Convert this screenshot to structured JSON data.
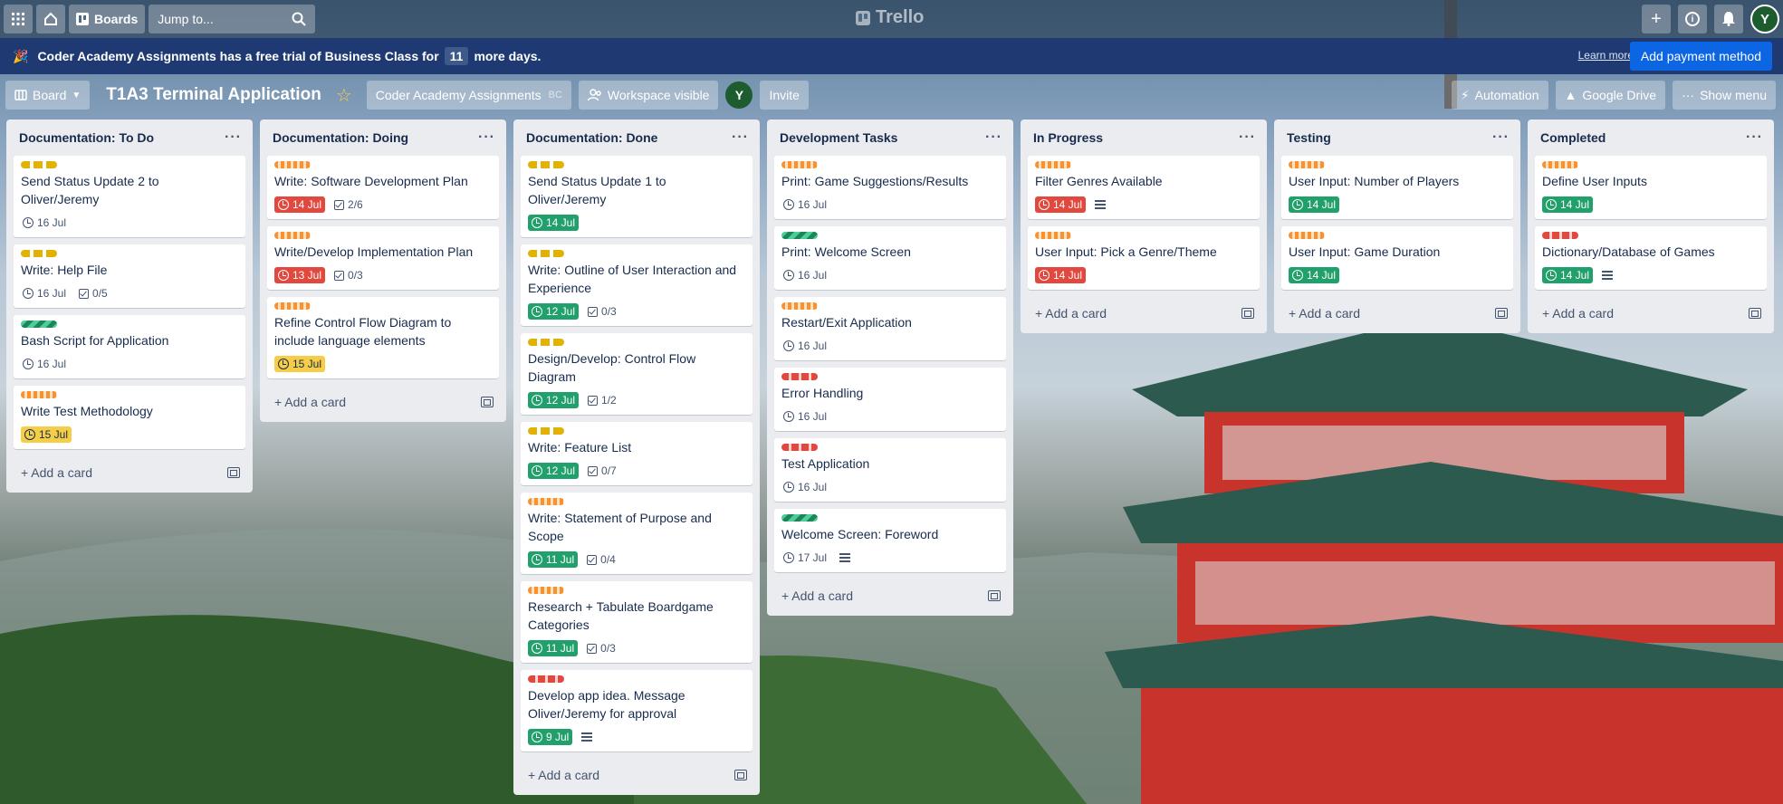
{
  "app": {
    "name": "Trello",
    "search_placeholder": "Jump to...",
    "boards_label": "Boards",
    "avatar_initial": "Y"
  },
  "banner": {
    "text_before": "Coder Academy Assignments has a free trial of Business Class for",
    "days": "11",
    "text_after": "more days.",
    "learn_more": "Learn more",
    "payment_button": "Add payment method"
  },
  "board_header": {
    "view_label": "Board",
    "title": "T1A3 Terminal Application",
    "workspace": "Coder Academy Assignments",
    "workspace_badge": "BC",
    "visibility": "Workspace visible",
    "invite": "Invite",
    "automation": "Automation",
    "google_drive": "Google Drive",
    "show_menu": "Show menu"
  },
  "add_card_label": "Add a card",
  "lists": [
    {
      "name": "Documentation: To Do",
      "cards": [
        {
          "labels": [
            "yellow"
          ],
          "title": "Send Status Update 2 to Oliver/Jeremy",
          "due": "16 Jul",
          "due_style": "plain",
          "checklist": "",
          "desc": false
        },
        {
          "labels": [
            "yellow"
          ],
          "title": "Write: Help File",
          "due": "16 Jul",
          "due_style": "plain",
          "checklist": "0/5",
          "desc": false
        },
        {
          "labels": [
            "green"
          ],
          "title": "Bash Script for Application",
          "due": "16 Jul",
          "due_style": "plain",
          "checklist": "",
          "desc": false
        },
        {
          "labels": [
            "orange"
          ],
          "title": "Write Test Methodology",
          "due": "15 Jul",
          "due_style": "yellow",
          "checklist": "",
          "desc": false
        }
      ]
    },
    {
      "name": "Documentation: Doing",
      "cards": [
        {
          "labels": [
            "orange"
          ],
          "title": "Write: Software Development Plan",
          "due": "14 Jul",
          "due_style": "red",
          "checklist": "2/6",
          "desc": false
        },
        {
          "labels": [
            "orange"
          ],
          "title": "Write/Develop Implementation Plan",
          "due": "13 Jul",
          "due_style": "red",
          "checklist": "0/3",
          "desc": false
        },
        {
          "labels": [
            "orange"
          ],
          "title": "Refine Control Flow Diagram to include language elements",
          "due": "15 Jul",
          "due_style": "yellow",
          "checklist": "",
          "desc": false
        }
      ]
    },
    {
      "name": "Documentation: Done",
      "cards": [
        {
          "labels": [
            "yellow"
          ],
          "title": "Send Status Update 1 to Oliver/Jeremy",
          "due": "14 Jul",
          "due_style": "green",
          "checklist": "",
          "desc": false
        },
        {
          "labels": [
            "yellow"
          ],
          "title": "Write: Outline of User Interaction and Experience",
          "due": "12 Jul",
          "due_style": "green",
          "checklist": "0/3",
          "desc": false
        },
        {
          "labels": [
            "yellow"
          ],
          "title": "Design/Develop: Control Flow Diagram",
          "due": "12 Jul",
          "due_style": "green",
          "checklist": "1/2",
          "desc": false
        },
        {
          "labels": [
            "yellow"
          ],
          "title": "Write: Feature List",
          "due": "12 Jul",
          "due_style": "green",
          "checklist": "0/7",
          "desc": false
        },
        {
          "labels": [
            "orange"
          ],
          "title": "Write: Statement of Purpose and Scope",
          "due": "11 Jul",
          "due_style": "green",
          "checklist": "0/4",
          "desc": false
        },
        {
          "labels": [
            "orange"
          ],
          "title": "Research + Tabulate Boardgame Categories",
          "due": "11 Jul",
          "due_style": "green",
          "checklist": "0/3",
          "desc": false
        },
        {
          "labels": [
            "red"
          ],
          "title": "Develop app idea. Message Oliver/Jeremy for approval",
          "due": "9 Jul",
          "due_style": "green",
          "checklist": "",
          "desc": true
        }
      ]
    },
    {
      "name": "Development Tasks",
      "cards": [
        {
          "labels": [
            "orange"
          ],
          "title": "Print: Game Suggestions/Results",
          "due": "16 Jul",
          "due_style": "plain",
          "checklist": "",
          "desc": false
        },
        {
          "labels": [
            "green"
          ],
          "title": "Print: Welcome Screen",
          "due": "16 Jul",
          "due_style": "plain",
          "checklist": "",
          "desc": false
        },
        {
          "labels": [
            "orange"
          ],
          "title": "Restart/Exit Application",
          "due": "16 Jul",
          "due_style": "plain",
          "checklist": "",
          "desc": false
        },
        {
          "labels": [
            "red"
          ],
          "title": "Error Handling",
          "due": "16 Jul",
          "due_style": "plain",
          "checklist": "",
          "desc": false
        },
        {
          "labels": [
            "red"
          ],
          "title": "Test Application",
          "due": "16 Jul",
          "due_style": "plain",
          "checklist": "",
          "desc": false
        },
        {
          "labels": [
            "green"
          ],
          "title": "Welcome Screen: Foreword",
          "due": "17 Jul",
          "due_style": "plain",
          "checklist": "",
          "desc": true
        }
      ]
    },
    {
      "name": "In Progress",
      "cards": [
        {
          "labels": [
            "orange"
          ],
          "title": "Filter Genres Available",
          "due": "14 Jul",
          "due_style": "red",
          "checklist": "",
          "desc": true
        },
        {
          "labels": [
            "orange"
          ],
          "title": "User Input: Pick a Genre/Theme",
          "due": "14 Jul",
          "due_style": "red",
          "checklist": "",
          "desc": false
        }
      ]
    },
    {
      "name": "Testing",
      "cards": [
        {
          "labels": [
            "orange"
          ],
          "title": "User Input: Number of Players",
          "due": "14 Jul",
          "due_style": "green",
          "checklist": "",
          "desc": false
        },
        {
          "labels": [
            "orange"
          ],
          "title": "User Input: Game Duration",
          "due": "14 Jul",
          "due_style": "green",
          "checklist": "",
          "desc": false
        }
      ]
    },
    {
      "name": "Completed",
      "cards": [
        {
          "labels": [
            "orange"
          ],
          "title": "Define User Inputs",
          "due": "14 Jul",
          "due_style": "green",
          "checklist": "",
          "desc": false
        },
        {
          "labels": [
            "red"
          ],
          "title": "Dictionary/Database of Games",
          "due": "14 Jul",
          "due_style": "green",
          "checklist": "",
          "desc": true
        }
      ]
    }
  ]
}
